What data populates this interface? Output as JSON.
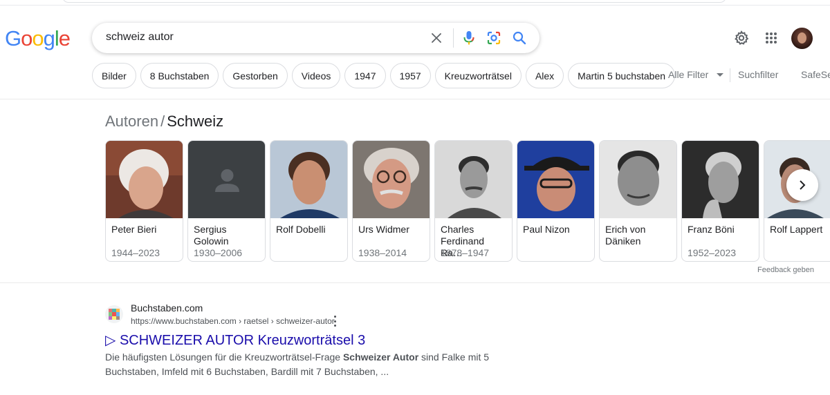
{
  "logo": {
    "letters": [
      "G",
      "o",
      "o",
      "g",
      "l",
      "e"
    ]
  },
  "search": {
    "query": "schweiz autor"
  },
  "header_icons": [
    "settings-gear-icon",
    "apps-grid-icon",
    "avatar"
  ],
  "chips": [
    "Bilder",
    "8 Buchstaben",
    "Gestorben",
    "Videos",
    "1947",
    "1957",
    "Kreuzworträtsel",
    "Alex",
    "Martin 5 buchstaben"
  ],
  "filters": {
    "all_filters": "Alle Filter",
    "search_filters": "Suchfilter",
    "safesearch": "SafeSe"
  },
  "breadcrumb": {
    "parent": "Autoren",
    "separator": "/",
    "current": "Schweiz"
  },
  "authors": [
    {
      "name": "Peter Bieri",
      "years": "1944–2023",
      "photo": "color"
    },
    {
      "name": "Sergius Golowin",
      "years": "1930–2006",
      "photo": "placeholder"
    },
    {
      "name": "Rolf Dobelli",
      "years": "",
      "photo": "color"
    },
    {
      "name": "Urs Widmer",
      "years": "1938–2014",
      "photo": "color"
    },
    {
      "name": "Charles Ferdinand Ra…",
      "years": "1878–1947",
      "photo": "bw"
    },
    {
      "name": "Paul Nizon",
      "years": "",
      "photo": "color"
    },
    {
      "name": "Erich von Däniken",
      "years": "",
      "photo": "bw"
    },
    {
      "name": "Franz Böni",
      "years": "1952–2023",
      "photo": "bw"
    },
    {
      "name": "Rolf Lappert",
      "years": "",
      "photo": "color"
    }
  ],
  "feedback": "Feedback geben",
  "result": {
    "site_name": "Buchstaben.com",
    "url": "https://www.buchstaben.com › raetsel › schweizer-autor",
    "title": "▷ SCHWEIZER AUTOR Kreuzworträtsel 3",
    "snippet_pre": "Die häufigsten Lösungen für die Kreuzworträtsel-Frage ",
    "snippet_bold": "Schweizer Autor",
    "snippet_post": " sind Falke mit 5 Buchstaben, Imfeld mit 6 Buchstaben, Bardill mit 7 Buchstaben, ..."
  },
  "colors": {
    "link": "#1a0dab",
    "muted": "#70757a",
    "google_blue": "#4285f4",
    "google_red": "#ea4335",
    "google_yellow": "#fbbc05",
    "google_green": "#34a853"
  }
}
